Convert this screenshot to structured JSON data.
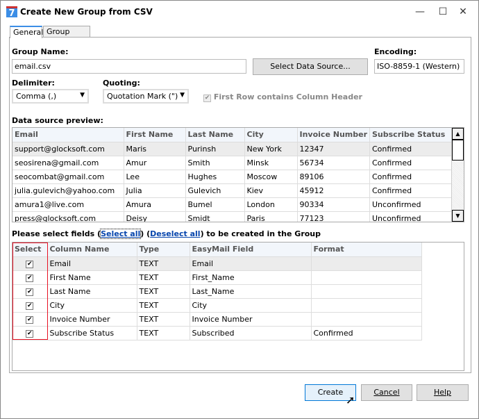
{
  "window": {
    "title": "Create New Group from CSV",
    "minimize": "—",
    "maximize": "☐",
    "close": "✕"
  },
  "tabs": [
    {
      "label": "General"
    },
    {
      "label": "Group Links"
    }
  ],
  "form": {
    "group_name_label": "Group Name:",
    "group_name_value": "email.csv",
    "select_source_label": "Select Data Source...",
    "encoding_label": "Encoding:",
    "encoding_value": "ISO-8859-1 (Western)",
    "delimiter_label": "Delimiter:",
    "delimiter_value": "Comma (,)",
    "quoting_label": "Quoting:",
    "quoting_value": "Quotation Mark (\")",
    "first_row_label": "First Row contains Column Header",
    "first_row_checked": true
  },
  "preview": {
    "label": "Data source preview:",
    "columns": [
      "Email",
      "First Name",
      "Last Name",
      "City",
      "Invoice Number",
      "Subscribe Status"
    ],
    "rows": [
      [
        "support@glocksoft.com",
        "Maris",
        "Purinsh",
        "New York",
        "12347",
        "Confirmed"
      ],
      [
        "seosirena@gmail.com",
        "Amur",
        "Smith",
        "Minsk",
        "56734",
        "Confirmed"
      ],
      [
        "seocombat@gmail.com",
        "Lee",
        "Hughes",
        "Moscow",
        "89106",
        "Confirmed"
      ],
      [
        "julia.gulevich@yahoo.com",
        "Julia",
        "Gulevich",
        "Kiev",
        "45912",
        "Confirmed"
      ],
      [
        "amura1@live.com",
        "Amura",
        "Bumel",
        "London",
        "90334",
        "Unconfirmed"
      ],
      [
        "press@glocksoft.com",
        "Deisy",
        "Smidt",
        "Paris",
        "77123",
        "Unconfirmed"
      ]
    ]
  },
  "fields": {
    "prefix": "Please select fields (",
    "select_all": "Select all",
    "mid": ") (",
    "deselect_all": "Deselect all",
    "suffix": ") to be created in the Group",
    "columns": [
      "Select",
      "Column Name",
      "Type",
      "EasyMail Field",
      "Format"
    ],
    "rows": [
      {
        "checked": true,
        "name": "Email",
        "type": "TEXT",
        "field": "Email",
        "format": ""
      },
      {
        "checked": true,
        "name": "First Name",
        "type": "TEXT",
        "field": "First_Name",
        "format": ""
      },
      {
        "checked": true,
        "name": "Last Name",
        "type": "TEXT",
        "field": "Last_Name",
        "format": ""
      },
      {
        "checked": true,
        "name": "City",
        "type": "TEXT",
        "field": "City",
        "format": ""
      },
      {
        "checked": true,
        "name": "Invoice Number",
        "type": "TEXT",
        "field": "Invoice Number",
        "format": ""
      },
      {
        "checked": true,
        "name": "Subscribe Status",
        "type": "TEXT",
        "field": "Subscribed",
        "format": "Confirmed"
      }
    ]
  },
  "buttons": {
    "create": "Create",
    "cancel": "Cancel",
    "help": "Help"
  },
  "colors": {
    "accent": "#3c8ee6",
    "highlight": "#e81123",
    "link": "#0645ad"
  }
}
